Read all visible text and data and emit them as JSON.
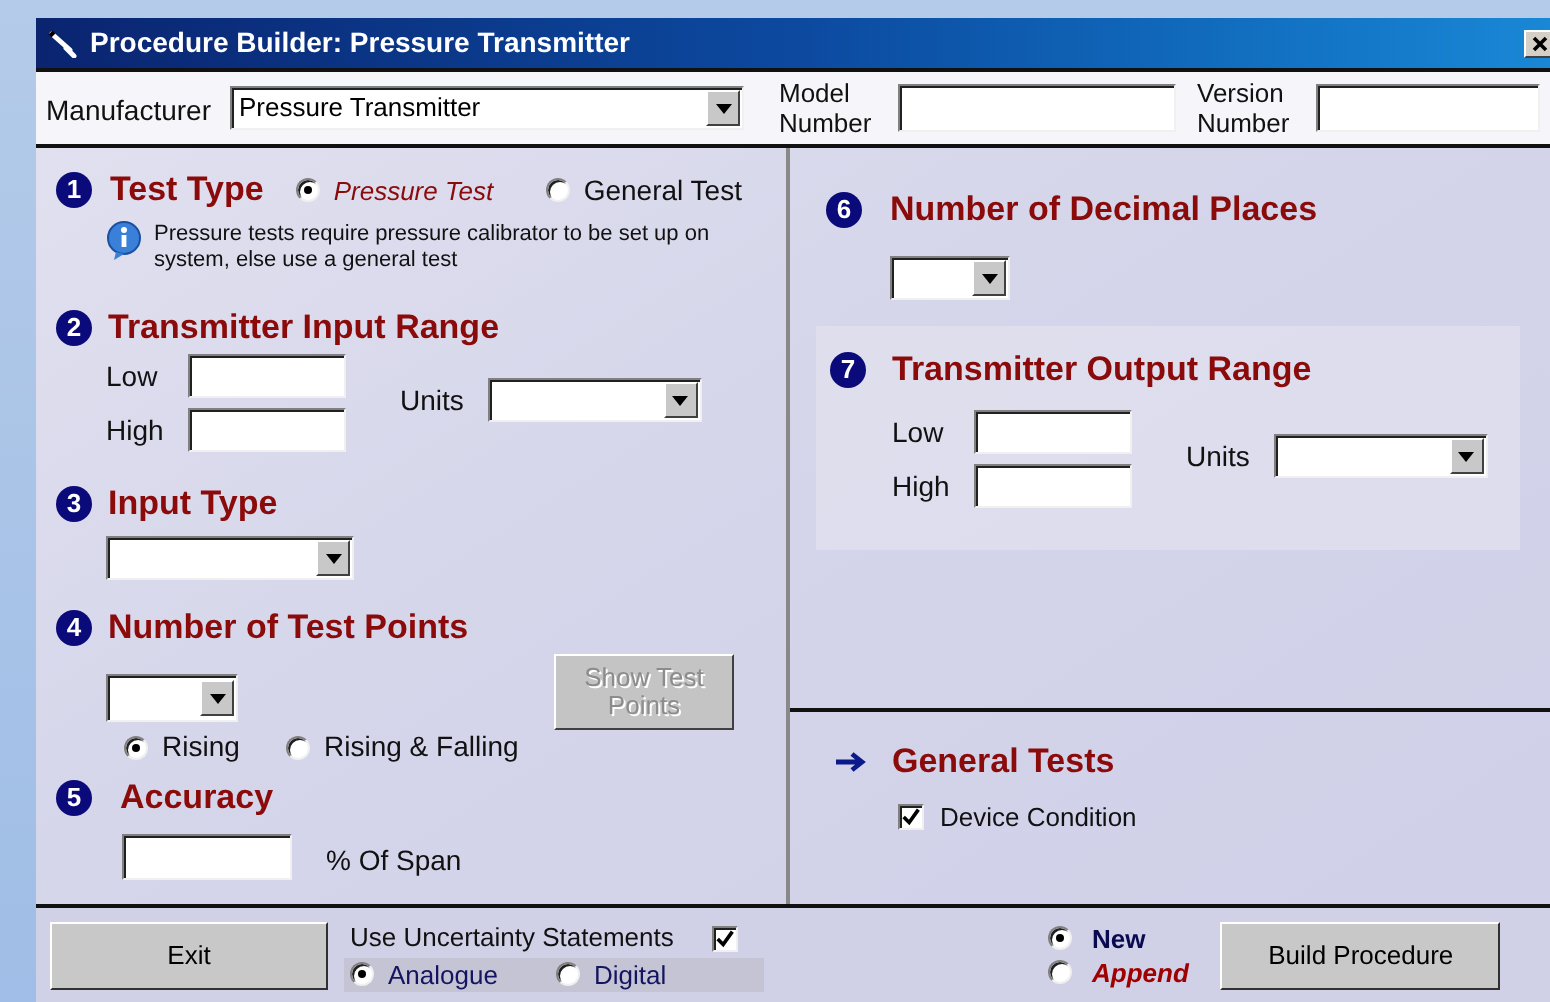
{
  "window": {
    "title": "Procedure Builder: Pressure Transmitter"
  },
  "header": {
    "manufacturer": {
      "label": "Manufacturer",
      "value": "Pressure Transmitter"
    },
    "model_number": {
      "label": "Model Number"
    },
    "version_number": {
      "label": "Version Number"
    }
  },
  "test_type": {
    "number": "1",
    "title": "Test Type",
    "options": [
      {
        "label": "Pressure Test",
        "selected": true
      },
      {
        "label": "General Test",
        "selected": false
      }
    ],
    "note": "Pressure tests require pressure calibrator to be set up on system, else use a general test"
  },
  "input_range": {
    "number": "2",
    "title": "Transmitter Input Range",
    "low_label": "Low",
    "high_label": "High",
    "units_label": "Units"
  },
  "input_type": {
    "number": "3",
    "title": "Input Type"
  },
  "test_points": {
    "number": "4",
    "title": "Number of Test Points",
    "show_button": {
      "label": "Show Test Points",
      "disabled": true
    },
    "directions": [
      {
        "label": "Rising",
        "selected": true
      },
      {
        "label": "Rising & Falling",
        "selected": false
      }
    ]
  },
  "accuracy": {
    "number": "5",
    "title": "Accuracy",
    "unit": "% Of Span"
  },
  "decimal_places": {
    "number": "6",
    "title": "Number of Decimal Places"
  },
  "output_range": {
    "number": "7",
    "title": "Transmitter Output Range",
    "low_label": "Low",
    "high_label": "High",
    "units_label": "Units"
  },
  "general_tests": {
    "title": "General Tests",
    "items": [
      {
        "label": "Device Condition",
        "checked": true
      }
    ]
  },
  "footer": {
    "exit": "Exit",
    "uncertainty": {
      "label": "Use Uncertainty Statements",
      "checked": true,
      "options": [
        {
          "label": "Analogue",
          "selected": true
        },
        {
          "label": "Digital",
          "selected": false
        }
      ]
    },
    "modes": [
      {
        "label": "New",
        "selected": true
      },
      {
        "label": "Append",
        "selected": false
      }
    ],
    "build": "Build Procedure"
  }
}
